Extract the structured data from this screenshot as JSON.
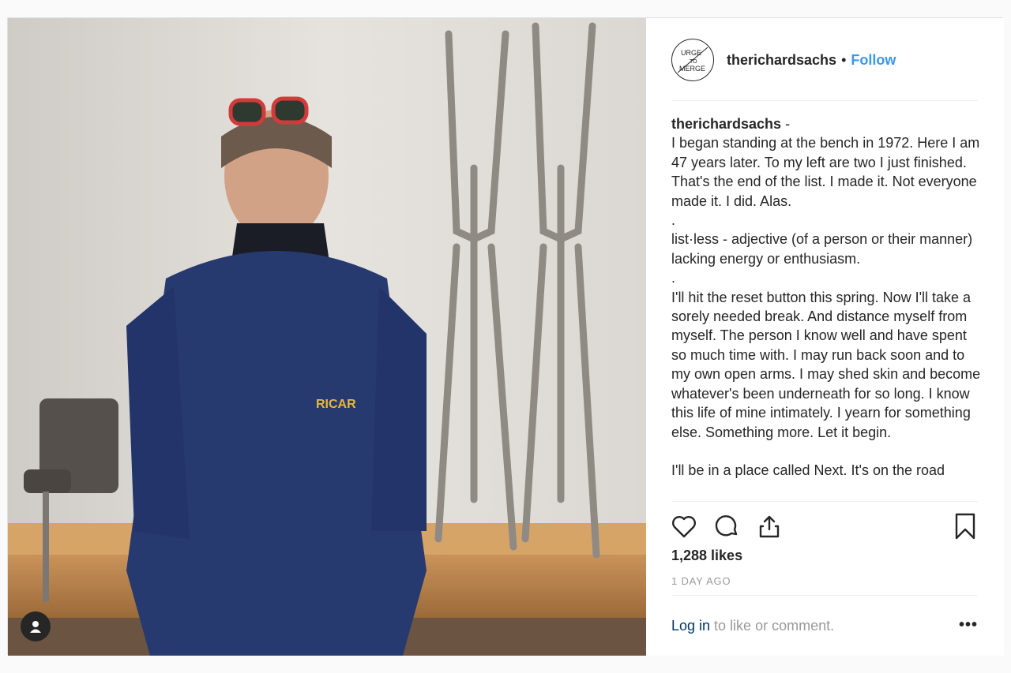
{
  "header": {
    "avatar_text_line1": "URGE",
    "avatar_text_line2": "TO",
    "avatar_text_line3": "MERGE",
    "username": "therichardsachs",
    "separator": "•",
    "follow_label": "Follow"
  },
  "caption": {
    "username": "therichardsachs",
    "dash": " -",
    "paragraphs": [
      "I began standing at the bench in 1972. Here I am 47 years later. To my left are two I just finished. That's the end of the list. I made it. Not everyone made it. I did. Alas.",
      ".",
      "list·less - adjective (of a person or their manner) lacking energy or enthusiasm.",
      ".",
      "I'll hit the reset button this spring. Now I'll take a sorely needed break. And distance myself from myself. The person I know well and have spent so much time with. I may run back soon and to my own open arms. I may shed skin and become whatever's been underneath for so long. I know this life of mine intimately. I yearn for something else. Something more. Let it begin.",
      "",
      "I'll be in a place called Next. It's on the road"
    ]
  },
  "photo": {
    "shirt_text": "RICAR"
  },
  "actions": {
    "like_icon": "heart-icon",
    "comment_icon": "comment-icon",
    "share_icon": "share-icon",
    "save_icon": "bookmark-icon"
  },
  "likes": "1,288 likes",
  "timestamp": "1 DAY AGO",
  "footer": {
    "login_link": "Log in",
    "login_rest": " to like or comment.",
    "more_label": "•••"
  },
  "colors": {
    "link_blue": "#3897f0",
    "text": "#262626",
    "muted": "#999999",
    "login_blue": "#003569"
  }
}
